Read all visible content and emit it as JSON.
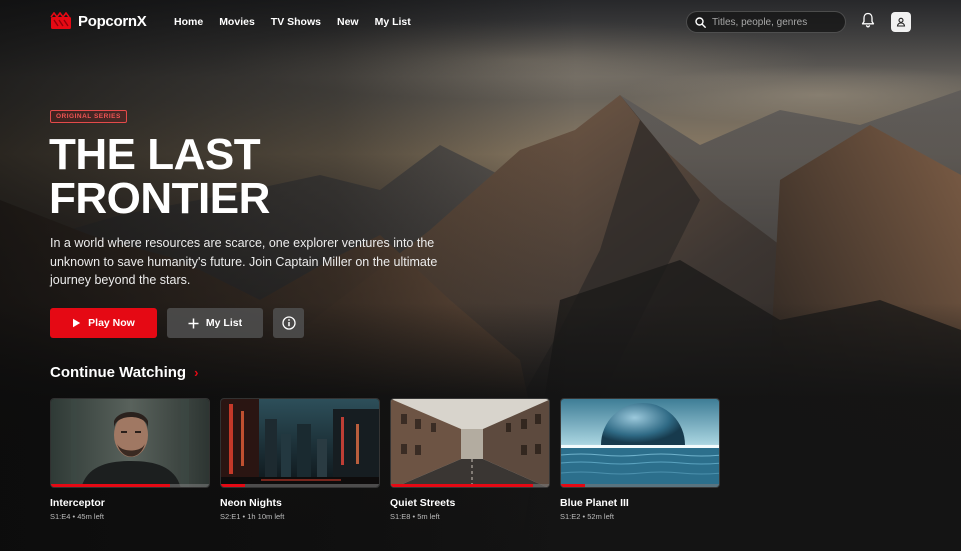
{
  "app": {
    "logo_text": "PopcornX"
  },
  "nav": {
    "links": [
      "Home",
      "Movies",
      "TV Shows",
      "New",
      "My List"
    ]
  },
  "search": {
    "placeholder": "Titles, people, genres",
    "value": ""
  },
  "header_icons": {
    "notifications": "bell-icon",
    "profile": "user-icon",
    "search": "search-icon"
  },
  "hero": {
    "badge": "ORIGINAL SERIES",
    "title_line1": "THE LAST",
    "title_line2": "FRONTIER",
    "description": "In a world where resources are scarce, one explorer ventures into the unknown to save humanity's future. Join Captain Miller on the ultimate journey beyond the stars.",
    "play_label": "Play Now",
    "mylist_label": "My List"
  },
  "continue_watching": {
    "title": "Continue Watching",
    "items": [
      {
        "title": "Interceptor",
        "meta": "S1:E4 • 45m left",
        "progress": 0.75
      },
      {
        "title": "Neon Nights",
        "meta": "S2:E1 • 1h 10m left",
        "progress": 0.15
      },
      {
        "title": "Quiet Streets",
        "meta": "S1:E8 • 5m left",
        "progress": 0.9
      },
      {
        "title": "Blue Planet III",
        "meta": "S1:E2 • 52m left",
        "progress": 0.15
      }
    ]
  },
  "colors": {
    "accent": "#e50914",
    "background": "#141414"
  }
}
